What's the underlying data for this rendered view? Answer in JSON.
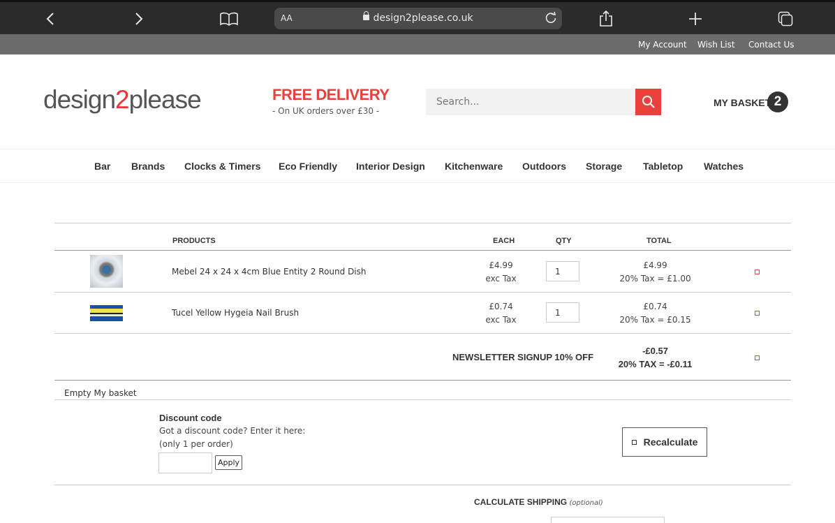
{
  "browser": {
    "aa_label": "AA",
    "url": "design2please.co.uk"
  },
  "top_nav": {
    "my_account": "My Account",
    "wish_list": "Wish List",
    "contact_us": "Contact Us"
  },
  "header": {
    "logo_prefix": "design",
    "logo_two": "2",
    "logo_suffix": "please",
    "delivery_title": "FREE DELIVERY",
    "delivery_sub": "- On UK orders over £30 -",
    "search_placeholder": "Search...",
    "basket_label": "MY BASKET",
    "basket_count": "2"
  },
  "categories": [
    "Bar",
    "Brands",
    "Clocks & Timers",
    "Eco Friendly",
    "Interior Design",
    "Kitchenware",
    "Outdoors",
    "Storage",
    "Tabletop",
    "Watches"
  ],
  "table": {
    "headers": {
      "products": "PRODUCTS",
      "each": "EACH",
      "qty": "QTY",
      "total": "TOTAL"
    },
    "rows": [
      {
        "name": "Mebel 24 x 24 x 4cm Blue Entity 2 Round Dish",
        "price": "£4.99",
        "price_note": "exc Tax",
        "qty": "1",
        "total": "£4.99",
        "tax": "20% Tax = £1.00"
      },
      {
        "name": "Tucel Yellow Hygeia Nail Brush",
        "price": "£0.74",
        "price_note": "exc Tax",
        "qty": "1",
        "total": "£0.74",
        "tax": "20% Tax = £0.15"
      }
    ],
    "discount": {
      "label": "NEWSLETTER SIGNUP 10% OFF",
      "amount": "-£0.57",
      "tax": "20% TAX = -£0.11"
    }
  },
  "empty_basket": "Empty My basket",
  "discount_code": {
    "title": "Discount code",
    "line1": "Got a discount code? Enter it here:",
    "line2": "(only 1 per order)",
    "apply_label": "Apply"
  },
  "recalculate_label": "Recalculate",
  "shipping": {
    "label": "CALCULATE SHIPPING",
    "optional": "(optional)"
  },
  "colors": {
    "brand_red": "#e8413c",
    "top_nav_bg": "#6b6b6b",
    "browser_bg": "#2b2b2b"
  }
}
